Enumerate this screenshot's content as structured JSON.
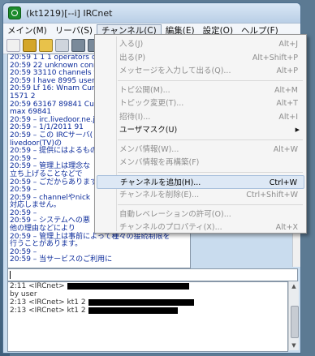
{
  "window": {
    "title": "(kt1219)[--i] IRCnet"
  },
  "menubar": [
    {
      "label": "メイン(M)"
    },
    {
      "label": "リーバ(S)"
    },
    {
      "label": "チャンネル(C)"
    },
    {
      "label": "編集(E)"
    },
    {
      "label": "設定(O)"
    },
    {
      "label": "ヘルプ(F)"
    }
  ],
  "toolbar": {
    "buttons": [
      "new-icon",
      "connect-icon",
      "folder-icon",
      "window-icon",
      "disconnect-icon",
      "settings-icon"
    ]
  },
  "log": {
    "lines": [
      "20:59 1 1 1 operators online",
      "20:59 22 unknown connecti",
      "20:59 33110 channels form",
      "20:59 I have 8995 users",
      "20:59 Lf 16: Wnam Curre",
      "1571 2",
      "20:59 63167 89841 Curr",
      "max 69841",
      "20:59 – irc.livedoor.ne.jp",
      "20:59 –      1/1/2011 91",
      "20:59 – この IRCサーバ(",
      "livedoor(TV)の",
      "20:59 – 提供にはよるもの",
      "20:59 –",
      "20:59 – 管理上は理念な",
      "立ち上げることなどで",
      "20:59 – ごだからあります。",
      "20:59 –",
      "20:59 – channelやnick",
      "対応しません。",
      "20:59 –",
      "20:59 – システムへの悪",
      "他の理由などにより",
      "20:59 – 管理上は事前によって種々の接続制限を",
      "行うことがあります。",
      "20:59 –",
      "20:59 – 当サービスのご利用に"
    ]
  },
  "lower_log": {
    "lines": [
      "2:11 <IRCnet>",
      "by user",
      "2:13 <IRCnet> kt1 2",
      "2:13 <IRCnet> kt1 2"
    ]
  },
  "channel_menu": {
    "items": [
      {
        "label": "入る(J)",
        "shortcut": "Alt+J",
        "state": "disabled"
      },
      {
        "label": "出る(P)",
        "shortcut": "Alt+Shift+P",
        "state": "disabled"
      },
      {
        "label": "メッセージを入力して出る(Q)...",
        "shortcut": "Alt+P",
        "state": "disabled"
      },
      {
        "sep": true
      },
      {
        "label": "トピ公開(M)...",
        "shortcut": "Alt+M",
        "state": "disabled"
      },
      {
        "label": "トピック変更(T)...",
        "shortcut": "Alt+T",
        "state": "disabled"
      },
      {
        "label": "招待(I)...",
        "shortcut": "Alt+I",
        "state": "disabled"
      },
      {
        "label": "ユーザマスク(U)",
        "shortcut": "",
        "state": "enabled",
        "submenu": true
      },
      {
        "sep": true
      },
      {
        "label": "メンバ情報(W)...",
        "shortcut": "Alt+W",
        "state": "disabled"
      },
      {
        "label": "メンバ情報を再構築(F)",
        "shortcut": "",
        "state": "disabled"
      },
      {
        "sep": true
      },
      {
        "label": "チャンネルを追加(H)...",
        "shortcut": "Ctrl+W",
        "state": "hilite"
      },
      {
        "label": "チャンネルを削除(E)...",
        "shortcut": "Ctrl+Shift+W",
        "state": "disabled"
      },
      {
        "sep": true
      },
      {
        "label": "自動レベレーションの許可(O)...",
        "shortcut": "",
        "state": "disabled"
      },
      {
        "label": "チャンネルのプロパティ(X)...",
        "shortcut": "Alt+X",
        "state": "disabled"
      }
    ]
  }
}
